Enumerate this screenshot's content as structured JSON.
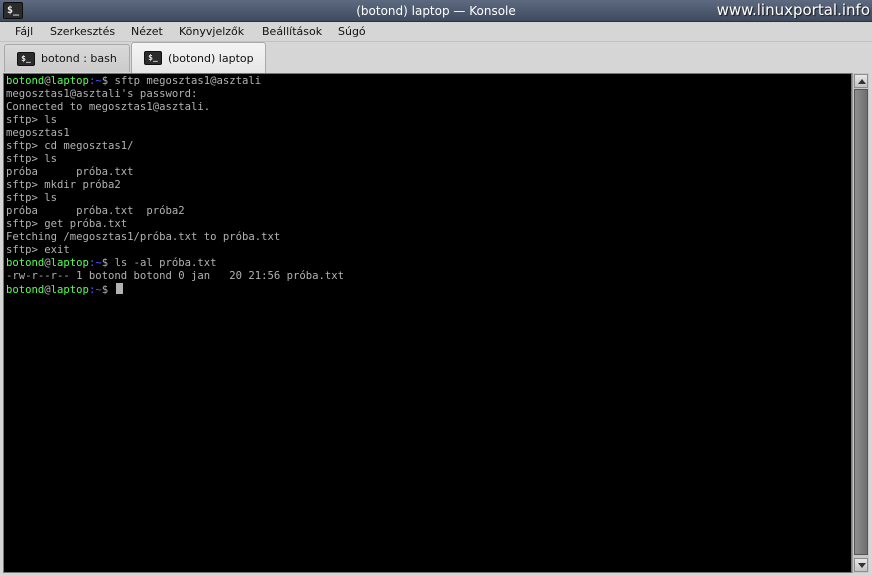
{
  "window": {
    "title": "(botond) laptop — Konsole",
    "app_icon": "terminal-icon",
    "app_icon_glyph": "$_",
    "watermark": "www.linuxportal.info"
  },
  "menubar": {
    "items": [
      "Fájl",
      "Szerkesztés",
      "Nézet",
      "Könyvjelzők",
      "Beállítások",
      "Súgó"
    ]
  },
  "tabs": [
    {
      "label": "botond : bash",
      "icon": "terminal-icon",
      "active": false
    },
    {
      "label": "(botond) laptop",
      "icon": "terminal-icon",
      "active": true
    }
  ],
  "terminal": {
    "prompt": {
      "user": "botond",
      "at": "@",
      "host": "laptop",
      "path": ":~",
      "symbol": "$"
    },
    "lines": [
      {
        "type": "prompt",
        "cmd": " sftp megosztas1@asztali"
      },
      {
        "type": "text",
        "text": "megosztas1@asztali's password:"
      },
      {
        "type": "text",
        "text": "Connected to megosztas1@asztali."
      },
      {
        "type": "text",
        "text": "sftp> ls"
      },
      {
        "type": "text",
        "text": "megosztas1"
      },
      {
        "type": "text",
        "text": "sftp> cd megosztas1/"
      },
      {
        "type": "text",
        "text": "sftp> ls"
      },
      {
        "type": "text",
        "text": "próba      próba.txt"
      },
      {
        "type": "text",
        "text": "sftp> mkdir próba2"
      },
      {
        "type": "text",
        "text": "sftp> ls"
      },
      {
        "type": "text",
        "text": "próba      próba.txt  próba2"
      },
      {
        "type": "text",
        "text": "sftp> get próba.txt"
      },
      {
        "type": "text",
        "text": "Fetching /megosztas1/próba.txt to próba.txt"
      },
      {
        "type": "text",
        "text": "sftp> exit"
      },
      {
        "type": "prompt",
        "cmd": " ls -al próba.txt"
      },
      {
        "type": "text",
        "text": "-rw-r--r-- 1 botond botond 0 jan   20 21:56 próba.txt"
      },
      {
        "type": "prompt",
        "cmd": " ",
        "cursor": true
      }
    ],
    "colors": {
      "background": "#000000",
      "text": "#b2b2b2",
      "user_host": "#54ff54",
      "path": "#5454ff"
    }
  },
  "scrollbar": {
    "up_icon": "scroll-up-icon",
    "down_icon": "scroll-down-icon"
  }
}
